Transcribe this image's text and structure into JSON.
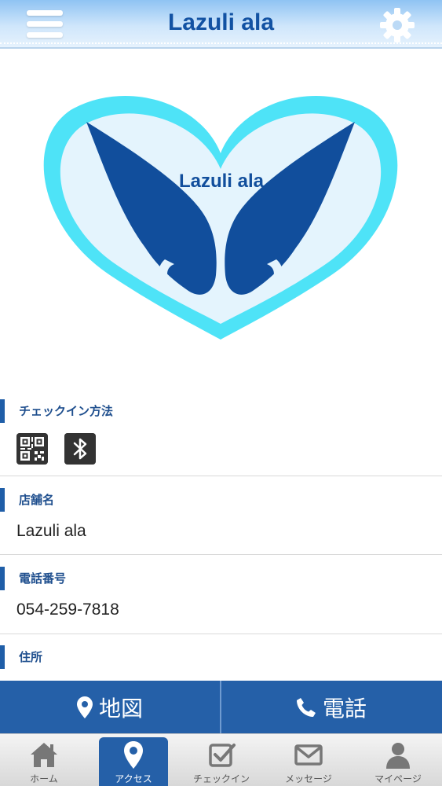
{
  "header": {
    "title": "Lazuli ala",
    "menu_icon": "hamburger-icon",
    "settings_icon": "gear-icon"
  },
  "logo": {
    "text": "Lazuli ala",
    "colors": {
      "heart": "#4ee3f7",
      "heart_inner": "#e4f4fd",
      "wings": "#114e9c"
    }
  },
  "sections": {
    "checkin": {
      "label": "チェックイン方法",
      "icons": [
        "qr-code-icon",
        "bluetooth-icon"
      ]
    },
    "store": {
      "label": "店舗名",
      "value": "Lazuli ala"
    },
    "phone": {
      "label": "電話番号",
      "value": "054-259-7818"
    },
    "address": {
      "label": "住所"
    }
  },
  "actions": {
    "map_label": "地図",
    "call_label": "電話"
  },
  "tabs": [
    {
      "label": "ホーム",
      "icon": "home-icon",
      "active": false
    },
    {
      "label": "アクセス",
      "icon": "map-pin-icon",
      "active": true
    },
    {
      "label": "チェックイン",
      "icon": "checkbox-icon",
      "active": false
    },
    {
      "label": "メッセージ",
      "icon": "envelope-icon",
      "active": false
    },
    {
      "label": "マイページ",
      "icon": "user-icon",
      "active": false
    }
  ],
  "colors": {
    "accent": "#2560a8",
    "label_text": "#1f4f8e",
    "header_title": "#1252a3"
  }
}
